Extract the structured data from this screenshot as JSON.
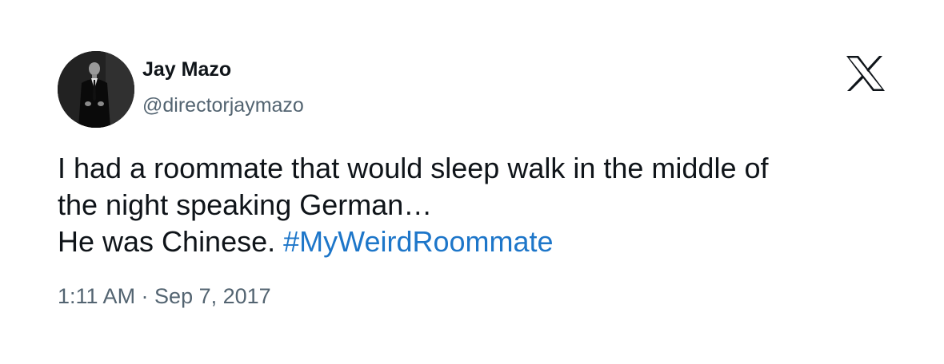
{
  "author": {
    "display_name": "Jay Mazo",
    "handle": "@directorjaymazo",
    "avatar_icon": "avatar-photo"
  },
  "platform": {
    "logo_icon": "x-logo-icon"
  },
  "tweet": {
    "line1": "I had a roommate that would sleep walk in the middle of",
    "line2": "the night speaking German…",
    "line3_text": "He was Chinese. ",
    "hashtag": "#MyWeirdRoommate",
    "timestamp": "1:11 AM · Sep 7, 2017"
  },
  "colors": {
    "text": "#0f1419",
    "secondary": "#536471",
    "link": "#1d76c9"
  }
}
